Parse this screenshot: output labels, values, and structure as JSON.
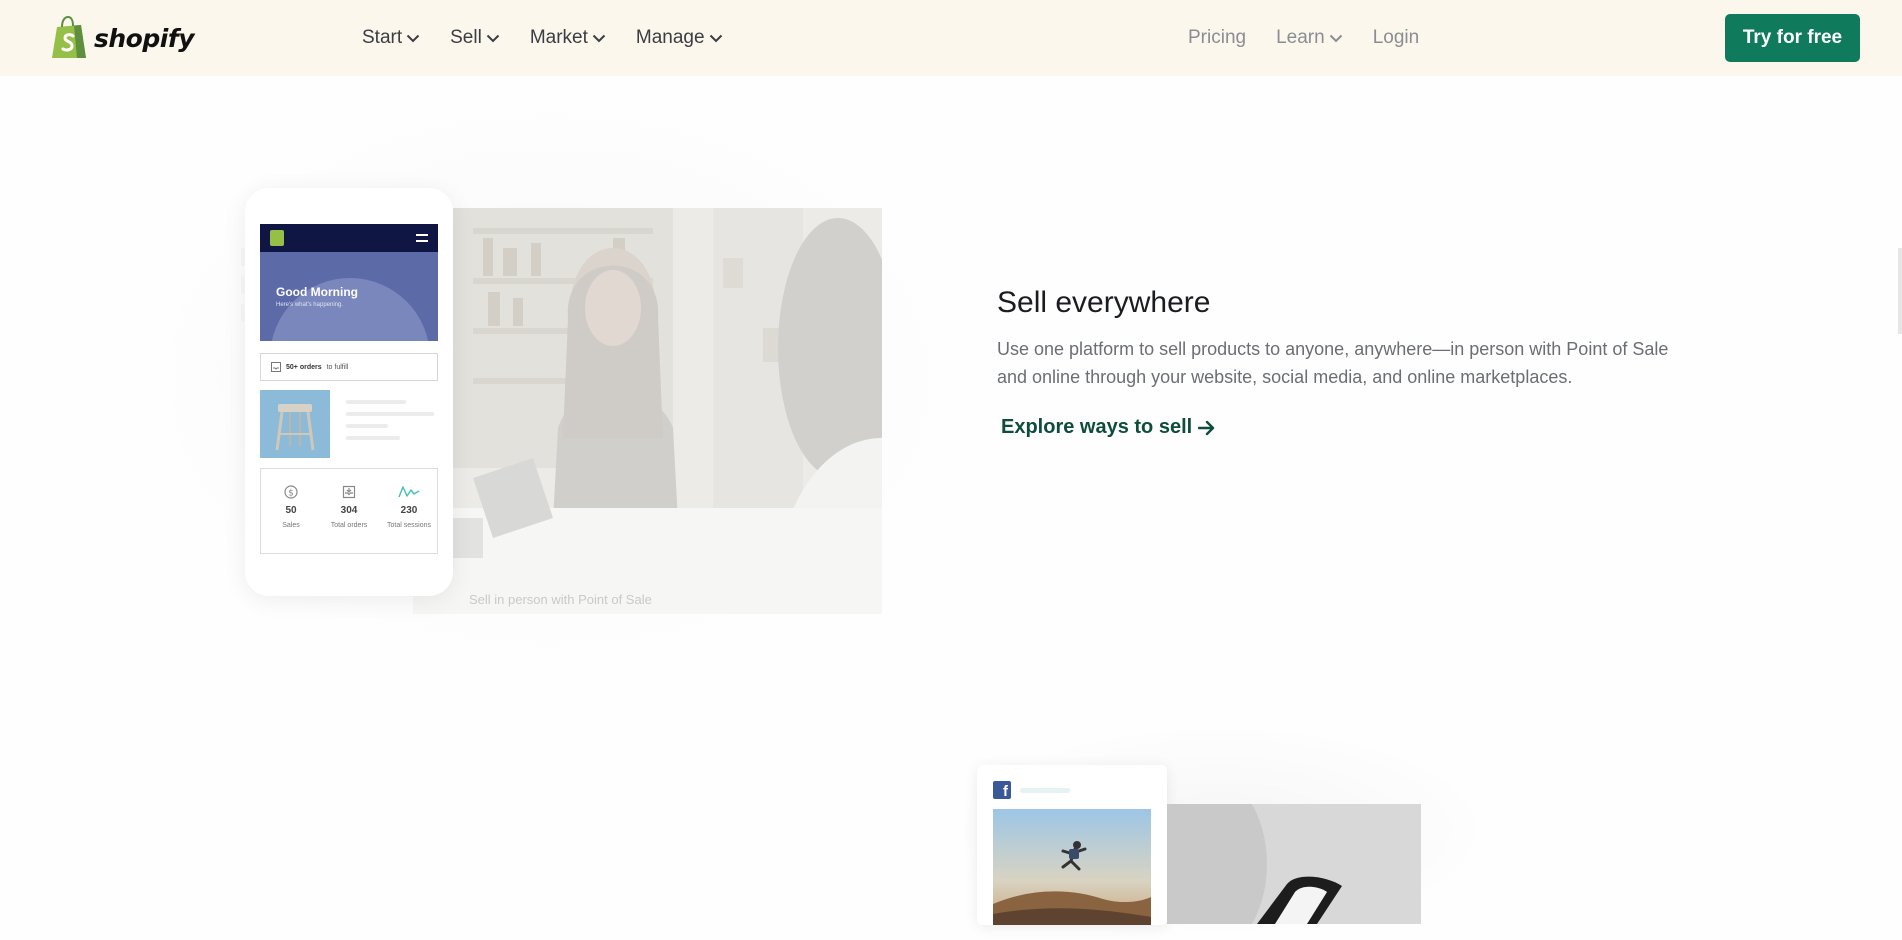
{
  "header": {
    "brand": "shopify",
    "nav_main": [
      {
        "label": "Start"
      },
      {
        "label": "Sell"
      },
      {
        "label": "Market"
      },
      {
        "label": "Manage"
      }
    ],
    "nav_right": {
      "pricing": "Pricing",
      "learn": "Learn",
      "login": "Login"
    },
    "cta_label": "Try for free"
  },
  "sell_section": {
    "title": "Sell everywhere",
    "description": "Use one platform to sell products to anyone, anywhere—in person with Point of Sale and online through your website, social media, and online marketplaces.",
    "link_label": "Explore ways to sell",
    "photo_caption": "Sell in person with Point of Sale",
    "phone_app": {
      "greeting": "Good Morning",
      "greeting_sub": "Here's what's happening.",
      "orders_bold": "50+ orders",
      "orders_rest": "to fulfill",
      "stats": [
        {
          "value": "50",
          "label": "Sales"
        },
        {
          "value": "304",
          "label": "Total orders"
        },
        {
          "value": "230",
          "label": "Total sessions"
        }
      ]
    }
  },
  "colors": {
    "header_bg": "#fbf7ed",
    "cta_green": "#0f7a5c",
    "link_green": "#0e4d3c",
    "app_navy": "#101644",
    "app_hero": "#5c6aa8"
  }
}
